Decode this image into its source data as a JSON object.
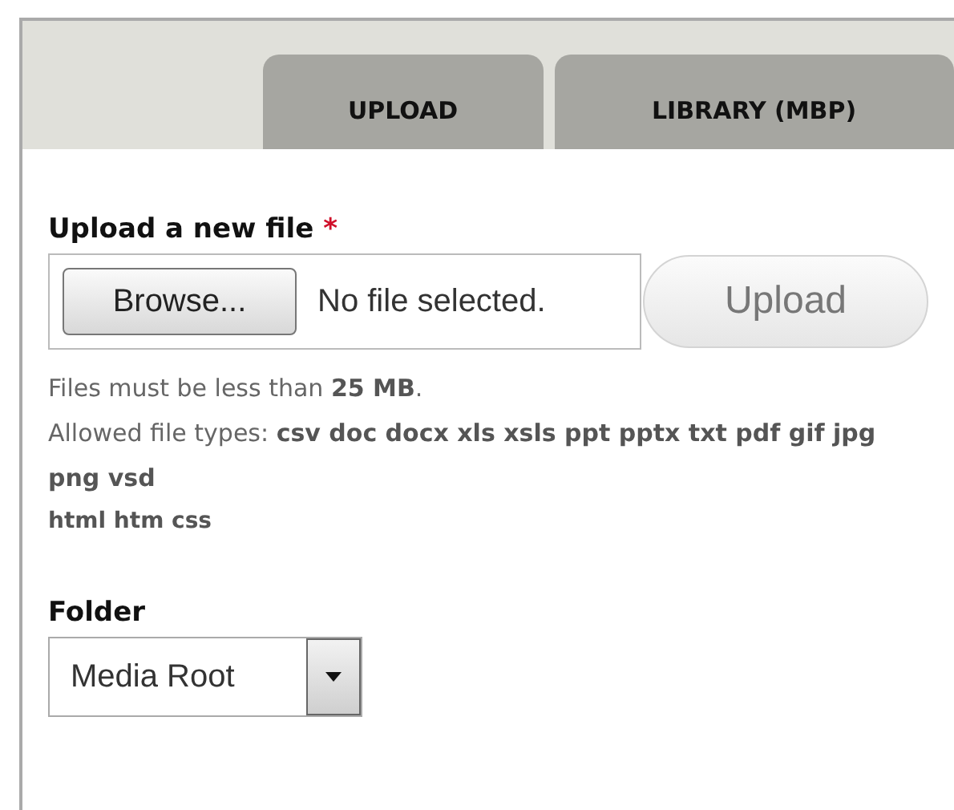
{
  "tabs": [
    {
      "label": "UPLOAD",
      "selected": false
    },
    {
      "label": "LIBRARY (MBP)",
      "selected": false
    }
  ],
  "upload_field": {
    "label": "Upload a new file",
    "required_mark": "*",
    "browse_button": "Browse...",
    "file_status": "No file selected.",
    "upload_button": {
      "label": "Upload",
      "disabled": true
    }
  },
  "help": {
    "size_limit": "Files must be less than **25 MB**.",
    "allowed_types": "Allowed file types: **csv doc docx xls xsls ppt pptx txt pdf gif jpg png vsd**",
    "allowed_types_extra": "html htm css"
  },
  "folder": {
    "label": "Folder",
    "value": "Media Root"
  }
}
